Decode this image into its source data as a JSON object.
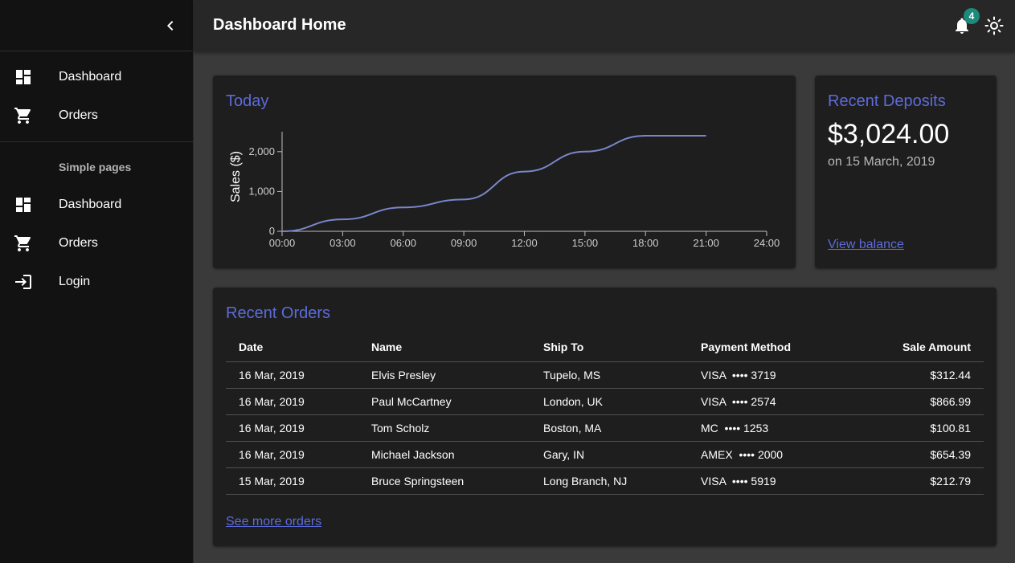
{
  "sidebar": {
    "primary": [
      {
        "label": "Dashboard",
        "icon": "dashboard-icon"
      },
      {
        "label": "Orders",
        "icon": "cart-icon"
      }
    ],
    "subheader": "Simple pages",
    "secondary": [
      {
        "label": "Dashboard",
        "icon": "dashboard-icon"
      },
      {
        "label": "Orders",
        "icon": "cart-icon"
      },
      {
        "label": "Login",
        "icon": "login-icon"
      }
    ]
  },
  "appbar": {
    "title": "Dashboard Home",
    "notification_count": "4"
  },
  "chart": {
    "title": "Today"
  },
  "chart_data": {
    "type": "line",
    "title": "Today",
    "xlabel": "",
    "ylabel": "Sales ($)",
    "x_ticks": [
      "00:00",
      "03:00",
      "06:00",
      "09:00",
      "12:00",
      "15:00",
      "18:00",
      "21:00",
      "24:00"
    ],
    "y_ticks": [
      "0",
      "1,000",
      "2,000"
    ],
    "xlim": [
      0,
      24
    ],
    "ylim": [
      0,
      2500
    ],
    "grid": false,
    "series": [
      {
        "x": [
          0,
          3,
          6,
          9,
          12,
          15,
          18,
          21
        ],
        "y": [
          0,
          300,
          600,
          800,
          1500,
          2000,
          2400,
          2400
        ],
        "color": "#7986cb"
      }
    ]
  },
  "deposits": {
    "title": "Recent Deposits",
    "amount": "$3,024.00",
    "date": "on 15 March, 2019",
    "link": "View balance"
  },
  "orders": {
    "title": "Recent Orders",
    "columns": [
      "Date",
      "Name",
      "Ship To",
      "Payment Method",
      "Sale Amount"
    ],
    "rows": [
      {
        "date": "16 Mar, 2019",
        "name": "Elvis Presley",
        "ship_to": "Tupelo, MS",
        "payment": "VISA  •••• 3719",
        "amount": "$312.44"
      },
      {
        "date": "16 Mar, 2019",
        "name": "Paul McCartney",
        "ship_to": "London, UK",
        "payment": "VISA  •••• 2574",
        "amount": "$866.99"
      },
      {
        "date": "16 Mar, 2019",
        "name": "Tom Scholz",
        "ship_to": "Boston, MA",
        "payment": "MC  •••• 1253",
        "amount": "$100.81"
      },
      {
        "date": "16 Mar, 2019",
        "name": "Michael Jackson",
        "ship_to": "Gary, IN",
        "payment": "AMEX  •••• 2000",
        "amount": "$654.39"
      },
      {
        "date": "15 Mar, 2019",
        "name": "Bruce Springsteen",
        "ship_to": "Long Branch, NJ",
        "payment": "VISA  •••• 5919",
        "amount": "$212.79"
      }
    ],
    "link": "See more orders"
  },
  "colors": {
    "accent": "#5c6bdb",
    "badge": "#1d8a7b",
    "line": "#7986cb"
  }
}
